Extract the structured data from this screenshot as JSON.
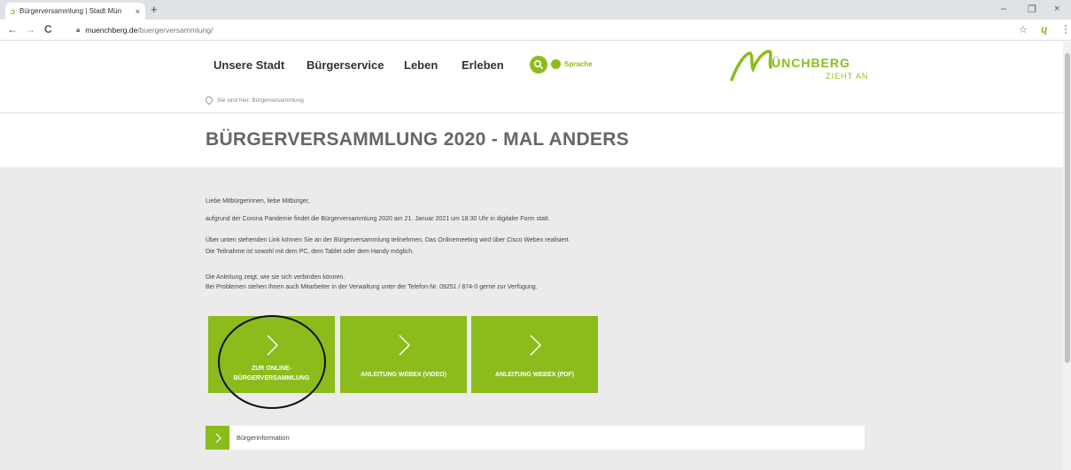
{
  "browser": {
    "tab_title": "Bürgerversammlung | Stadt Mün",
    "tab_close": "×",
    "new_tab": "+",
    "url_domain": "muenchberg.de",
    "url_path": "/buergerversammlung/",
    "controls": {
      "back": "←",
      "forward": "→",
      "reload": "C",
      "minimize": "–",
      "maximize": "❐",
      "close": "×",
      "star": "☆",
      "menu": "⋮"
    }
  },
  "header": {
    "nav": [
      "Unsere Stadt",
      "Bürgerservice",
      "Leben",
      "Erleben"
    ],
    "language_label": "Sprache",
    "logo": {
      "main": "ÜNCHBERG",
      "sub": "ZIEHT AN"
    },
    "breadcrumb": "Sie sind hier: Bürgerversammlung"
  },
  "page": {
    "title": "BÜRGERVERSAMMLUNG 2020 - MAL ANDERS",
    "paragraphs": {
      "greeting": "Liebe Mitbürgerinnen, liebe Mitbürger,",
      "p1": "aufgrund der Corona Pandemie findet die Bürgerversammlung 2020 am 21. Januar 2021 um 18:30 Uhr in digitaler Form statt.",
      "p2a": "Über unten stehenden Link können Sie an der Bürgerversammlung teilnehmen. Das Onlinemeeting wird über Cisco Webex realisiert.",
      "p2b": "Die Teilnahme ist sowohl mit dem PC, dem Tablet oder dem Handy möglich.",
      "p3a": "Die Anleitung zeigt, wie sie sich verbinden können.",
      "p3b": "Bei Problemen stehen Ihnen auch Mitarbeiter in der Verwaltung unter der Telefon-Nr. 09251 / 874-0 gerne zur Verfügung."
    },
    "tiles": [
      {
        "line1": "ZUR ONLINE-",
        "line2": "BÜRGERVERSAMMLUNG"
      },
      {
        "line1": "ANLEITUNG WEBEX (VIDEO)",
        "line2": ""
      },
      {
        "line1": "ANLEITUNG WEBEX (PDF)",
        "line2": ""
      }
    ],
    "info_label": "Bürgerinformation"
  },
  "colors": {
    "accent": "#8cbc1c",
    "gray_bg": "#ebebeb"
  },
  "icons": [
    "search-icon",
    "globe-icon",
    "pin-icon",
    "chevron-right-icon",
    "lock-icon"
  ]
}
